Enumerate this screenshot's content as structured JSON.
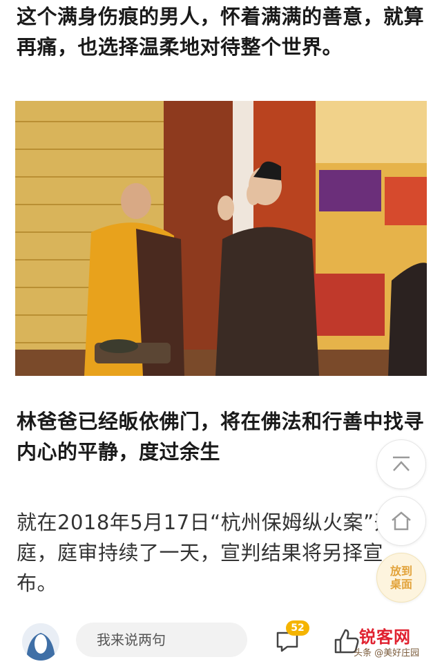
{
  "article": {
    "para_top": "这个满身伤痕的男人，怀着满满的善意，就算再痛，也选择温柔地对待整个世界。",
    "para_heading": "林爸爸已经皈依佛门，将在佛法和行善中找寻内心的平静，度过余生",
    "para_body": "就在2018年5月17日“杭州保姆纵火案”开庭，庭审持续了一天，宣判结果将另择宣布。"
  },
  "float_buttons": {
    "top_icon": "back-to-top-icon",
    "home_icon": "home-icon",
    "desktop_label_line1": "放到",
    "desktop_label_line2": "桌面"
  },
  "bottom_bar": {
    "comment_placeholder": "我来说两句",
    "comment_count": "52",
    "watermark_logo": "锐客网",
    "watermark_sub": "头条 @美好庄园"
  },
  "colors": {
    "accent_yellow": "#f5b400",
    "desktop_button_text": "#e2a33b",
    "watermark_red": "#e0212f"
  }
}
